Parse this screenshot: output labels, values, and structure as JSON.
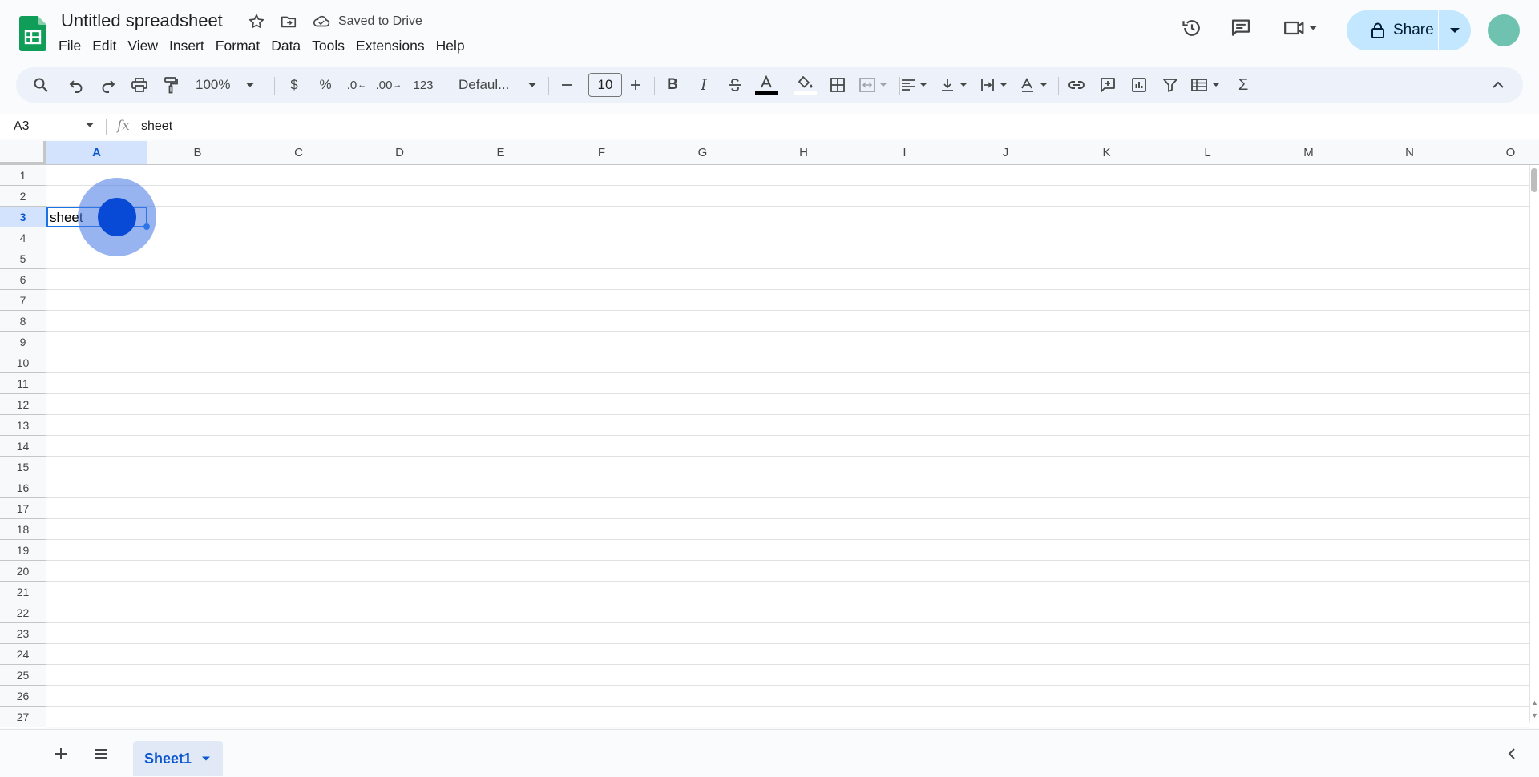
{
  "document": {
    "title": "Untitled spreadsheet",
    "save_status": "Saved to Drive"
  },
  "menu": {
    "items": [
      "File",
      "Edit",
      "View",
      "Insert",
      "Format",
      "Data",
      "Tools",
      "Extensions",
      "Help"
    ]
  },
  "header": {
    "share_label": "Share"
  },
  "toolbar": {
    "zoom": "100%",
    "currency": "$",
    "percent": "%",
    "decrease_decimal": ".0",
    "increase_decimal": ".00",
    "number_format": "123",
    "font_family": "Defaul...",
    "font_size": "10"
  },
  "formula_bar": {
    "name_box": "A3",
    "fx_label": "fx",
    "value": "sheet"
  },
  "grid": {
    "columns": [
      "A",
      "B",
      "C",
      "D",
      "E",
      "F",
      "G",
      "H",
      "I",
      "J",
      "K",
      "L",
      "M",
      "N",
      "O"
    ],
    "rows": [
      "1",
      "2",
      "3",
      "4",
      "5",
      "6",
      "7",
      "8",
      "9",
      "10",
      "11",
      "12",
      "13",
      "14",
      "15",
      "16",
      "17",
      "18",
      "19",
      "20",
      "21",
      "22",
      "23",
      "24",
      "25",
      "26",
      "27"
    ],
    "selected_cell": "A3",
    "cells": {
      "A3": "sheet"
    }
  },
  "sheets": {
    "tabs": [
      "Sheet1"
    ],
    "active": "Sheet1"
  },
  "colors": {
    "accent": "#0b57d0",
    "share_bg": "#c2e7ff",
    "sheets_green": "#0f9d58",
    "selection": "#1a73e8"
  }
}
